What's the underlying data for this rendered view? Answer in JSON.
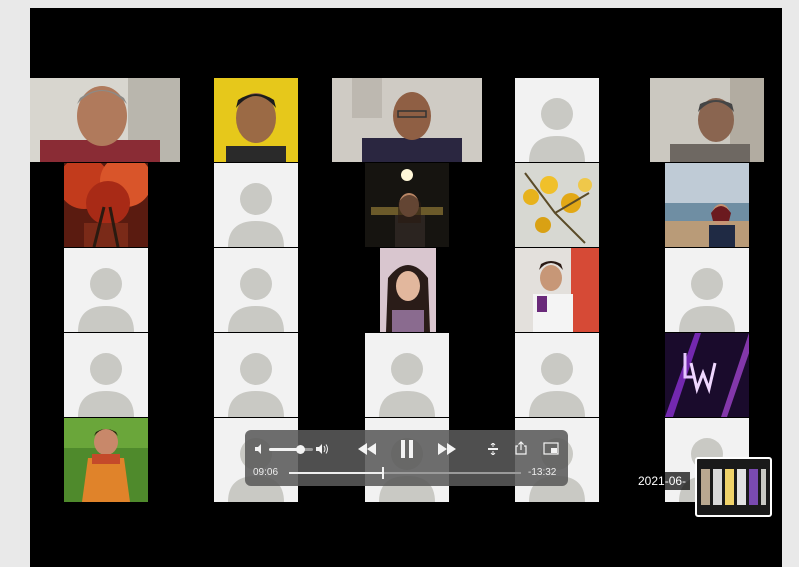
{
  "player": {
    "elapsed": "09:06",
    "remaining": "-13:32",
    "progress": 0.4,
    "volume": 0.7
  },
  "overlay": {
    "date_stamp": "2021-06-"
  },
  "icons": {
    "volume_low": "speaker-low-icon",
    "volume_high": "speaker-high-icon",
    "rewind": "rewind-icon",
    "pause": "pause-icon",
    "fast_forward": "fast-forward-icon",
    "airplay": "airplay-icon",
    "share": "share-icon",
    "pip": "picture-in-picture-icon"
  },
  "colors": {
    "placeholder_bg": "#f2f2f2",
    "placeholder_person": "#c9c9c4",
    "video_bg": "#000000"
  }
}
